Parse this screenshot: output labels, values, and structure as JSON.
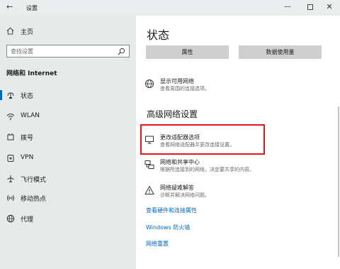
{
  "window": {
    "title": "设置",
    "minimize": "—",
    "close": "✕"
  },
  "sidebar": {
    "home": "主页",
    "search_placeholder": "查找设置",
    "section": "网络和 Internet",
    "items": [
      {
        "label": "状态",
        "icon": "status-icon",
        "active": true
      },
      {
        "label": "WLAN",
        "icon": "wifi-icon"
      },
      {
        "label": "拨号",
        "icon": "dialup-icon"
      },
      {
        "label": "VPN",
        "icon": "vpn-icon"
      },
      {
        "label": "飞行模式",
        "icon": "airplane-icon"
      },
      {
        "label": "移动热点",
        "icon": "hotspot-icon"
      },
      {
        "label": "代理",
        "icon": "globe-icon"
      }
    ]
  },
  "main": {
    "title": "状态",
    "buttons": {
      "properties": "属性",
      "data_usage": "数据使用量"
    },
    "show_networks": {
      "title": "显示可用网络",
      "desc": "查看周围的连接选项。"
    },
    "advanced_title": "高级网络设置",
    "adapter_options": {
      "title": "更改适配器选项",
      "desc": "查看网络适配器并更改连接设置。"
    },
    "sharing_center": {
      "title": "网络和共享中心",
      "desc": "根据所连接到的网络，决定要共享的内容。"
    },
    "troubleshooter": {
      "title": "网络疑难解答",
      "desc": "诊断并解决网络问题。"
    },
    "links": {
      "hardware": "查看硬件和连接属性",
      "firewall": "Windows 防火墙",
      "reset": "网络重置"
    }
  },
  "colors": {
    "accent": "#0067c0",
    "highlight": "#e8151c",
    "sidebar_bg": "#e6ebea"
  }
}
